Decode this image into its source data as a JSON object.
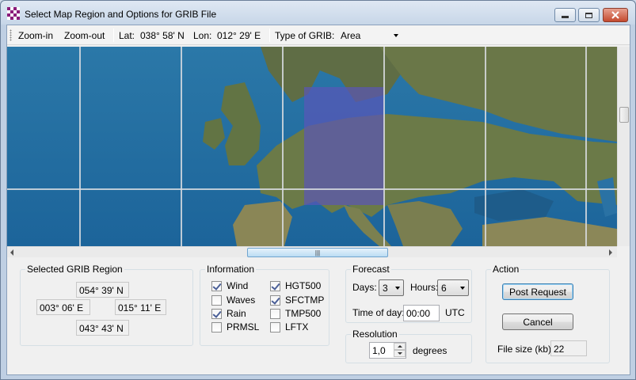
{
  "window": {
    "title": "Select Map Region and Options for GRIB File"
  },
  "toolbar": {
    "zoom_in": "Zoom-in",
    "zoom_out": "Zoom-out",
    "lat_label": "Lat:",
    "lat_value": "038° 58' N",
    "lon_label": "Lon:",
    "lon_value": "012° 29' E",
    "grib_type_label": "Type of GRIB:",
    "grib_type_value": "Area"
  },
  "region": {
    "title": "Selected GRIB Region",
    "north": "054° 39' N",
    "west": "003° 06' E",
    "east": "015° 11' E",
    "south": "043° 43' N"
  },
  "information": {
    "title": "Information",
    "items": [
      {
        "label": "Wind",
        "checked": true
      },
      {
        "label": "Waves",
        "checked": false
      },
      {
        "label": "Rain",
        "checked": true
      },
      {
        "label": "PRMSL",
        "checked": false
      },
      {
        "label": "HGT500",
        "checked": true
      },
      {
        "label": "SFCTMP",
        "checked": true
      },
      {
        "label": "TMP500",
        "checked": false
      },
      {
        "label": "LFTX",
        "checked": false
      }
    ]
  },
  "forecast": {
    "title": "Forecast",
    "days_label": "Days:",
    "days_value": "3",
    "hours_label": "Hours:",
    "hours_value": "6",
    "time_label": "Time of day:",
    "time_value": "00:00",
    "tz": "UTC"
  },
  "resolution": {
    "title": "Resolution",
    "value": "1,0",
    "unit": "degrees"
  },
  "action": {
    "title": "Action",
    "post": "Post Request",
    "cancel": "Cancel",
    "file_size_label": "File size (kb):",
    "file_size_value": "22"
  },
  "colors": {
    "sea": "#1a6fa3",
    "land": "#6f7d4a",
    "selection": "#5a55b8"
  }
}
